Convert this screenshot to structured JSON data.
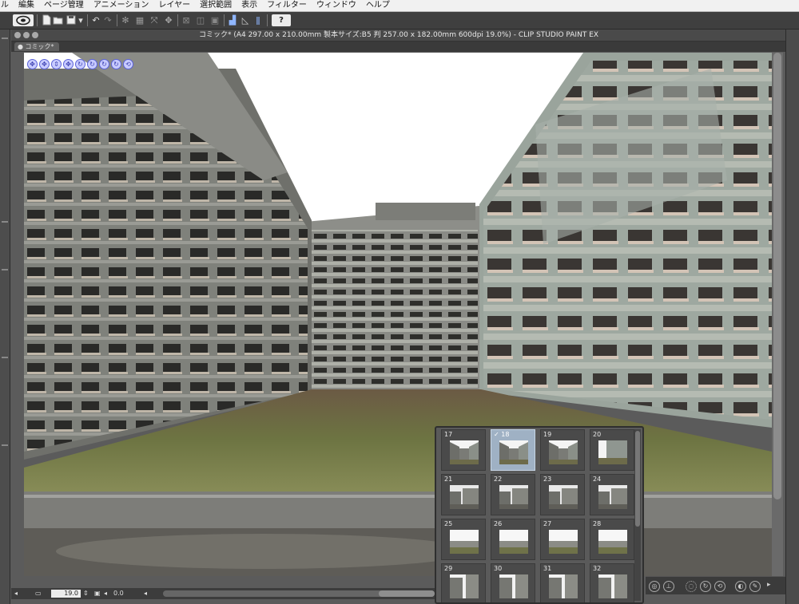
{
  "menubar": {
    "items": [
      "ル",
      "編集",
      "ページ管理",
      "アニメーション",
      "レイヤー",
      "選択範囲",
      "表示",
      "フィルター",
      "ウィンドウ",
      "ヘルプ"
    ]
  },
  "toolbar": {
    "help_label": "?"
  },
  "window": {
    "title": "コミック* (A4 297.00 x 210.00mm 製本サイズ:B5 判 257.00 x 182.00mm 600dpi 19.0%)  - CLIP STUDIO PAINT EX",
    "tab_label": "コミック*"
  },
  "statusbar": {
    "zoom": "19.0",
    "angle": "0.0"
  },
  "camera_tools": [
    "move-camera-icon",
    "pan-camera-icon",
    "zoom-camera-icon",
    "move-object-icon",
    "rotate-object-icon",
    "rotate-axis-icon",
    "scale-object-icon",
    "rotate-view-icon",
    "reset-view-icon"
  ],
  "presets": {
    "selected": "18",
    "items": [
      {
        "num": "17",
        "kind": "corridor"
      },
      {
        "num": "18",
        "kind": "corridor"
      },
      {
        "num": "19",
        "kind": "corridor"
      },
      {
        "num": "20",
        "kind": "side"
      },
      {
        "num": "21",
        "kind": "street"
      },
      {
        "num": "22",
        "kind": "street"
      },
      {
        "num": "23",
        "kind": "street"
      },
      {
        "num": "24",
        "kind": "street"
      },
      {
        "num": "25",
        "kind": "far"
      },
      {
        "num": "26",
        "kind": "far"
      },
      {
        "num": "27",
        "kind": "far"
      },
      {
        "num": "28",
        "kind": "far"
      },
      {
        "num": "29",
        "kind": "tall"
      },
      {
        "num": "30",
        "kind": "tall"
      },
      {
        "num": "31",
        "kind": "tall"
      },
      {
        "num": "32",
        "kind": "tall"
      }
    ]
  },
  "colors": {
    "sky": "#ffffff",
    "concrete": "#8e8f8a",
    "ground_green": "#6d7442",
    "ground_brown": "#6b5a44",
    "panel": "#5a5a5a",
    "selected_cell": "#9fb1c4"
  }
}
